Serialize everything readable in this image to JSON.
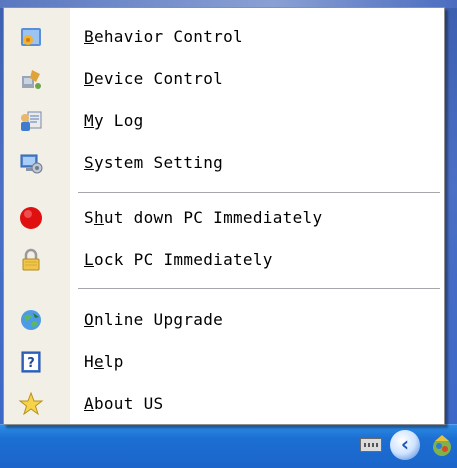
{
  "menu": {
    "items": [
      {
        "key": "B",
        "rest": "ehavior Control",
        "prefix": "",
        "icon": "behavior-control-icon"
      },
      {
        "key": "D",
        "rest": "evice Control",
        "prefix": "",
        "icon": "device-control-icon"
      },
      {
        "key": "M",
        "rest": "y Log",
        "prefix": "",
        "icon": "my-log-icon"
      },
      {
        "key": "S",
        "rest": "ystem Setting",
        "prefix": "",
        "icon": "system-setting-icon"
      },
      {
        "key": "h",
        "rest": "ut down PC Immediately",
        "prefix": "S",
        "icon": "shutdown-icon"
      },
      {
        "key": "L",
        "rest": "ock PC Immediately",
        "prefix": "",
        "icon": "lock-icon"
      },
      {
        "key": "O",
        "rest": "nline Upgrade",
        "prefix": "",
        "icon": "online-upgrade-icon"
      },
      {
        "key": "e",
        "rest": "lp",
        "prefix": "H",
        "icon": "help-icon"
      },
      {
        "key": "A",
        "rest": "bout US",
        "prefix": "",
        "icon": "about-icon"
      }
    ]
  },
  "colors": {
    "menu_bg": "#ffffff",
    "gutter": "#f1efe6",
    "taskbar": "#1c6fd3",
    "shutdown_red": "#e01010"
  }
}
